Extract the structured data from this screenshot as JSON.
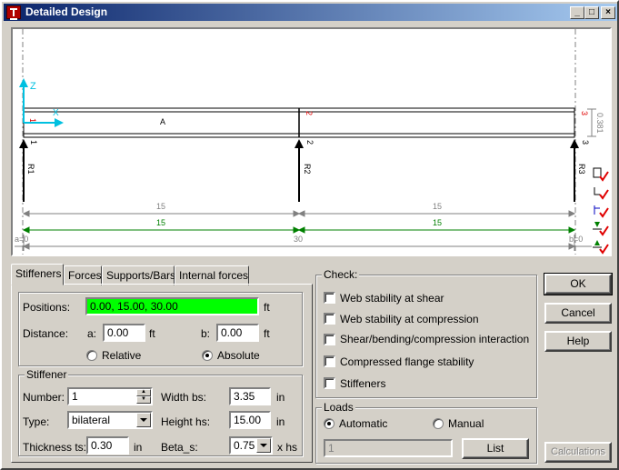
{
  "window": {
    "title": "Detailed Design"
  },
  "drawing": {
    "beam_label": "A",
    "dim_top": [
      "15",
      "15"
    ],
    "dim_bottom": [
      "15",
      "15"
    ],
    "total_left": "a=0",
    "total_mid": "30",
    "total_right": "b=0",
    "height_dim": "0.381",
    "axis_z": "Z",
    "axis_x": "X",
    "nodes_top": [
      "1",
      "2",
      "3"
    ],
    "nodes_support": [
      "1",
      "2",
      "3"
    ],
    "reactions": [
      "R1",
      "R2",
      "R3"
    ]
  },
  "tabs": [
    "Stiffeners",
    "Forces",
    "Supports/Bars",
    "Internal forces"
  ],
  "stiffeners": {
    "positions_label": "Positions:",
    "positions_value": "0.00, 15.00, 30.00",
    "positions_unit": "ft",
    "distance_label": "Distance:",
    "a_label": "a:",
    "a_value": "0.00",
    "a_unit": "ft",
    "b_label": "b:",
    "b_value": "0.00",
    "b_unit": "ft",
    "relative_label": "Relative",
    "absolute_label": "Absolute",
    "group_title": "Stiffener",
    "number_label": "Number:",
    "number_value": "1",
    "type_label": "Type:",
    "type_value": "bilateral",
    "thickness_label": "Thickness ts:",
    "thickness_value": "0.30",
    "thickness_unit": "in",
    "width_label": "Width bs:",
    "width_value": "3.35",
    "width_unit": "in",
    "height_label": "Height hs:",
    "height_value": "15.00",
    "height_unit": "in",
    "beta_label": "Beta_s:",
    "beta_value": "0.75",
    "beta_unit": "x  hs"
  },
  "check": {
    "title": "Check:",
    "items": [
      "Web stability at shear",
      "Web stability at compression",
      "Shear/bending/compression interaction",
      "Compressed flange stability",
      "Stiffeners"
    ]
  },
  "loads": {
    "title": "Loads",
    "automatic_label": "Automatic",
    "manual_label": "Manual",
    "value": "1",
    "list_button": "List"
  },
  "buttons": {
    "ok": "OK",
    "cancel": "Cancel",
    "help": "Help",
    "calculations": "Calculations"
  },
  "colors": {
    "accent_green": "#00ff00",
    "axis_cyan": "#00c0e0",
    "dim_green": "#008000",
    "node_red": "#e00000"
  }
}
